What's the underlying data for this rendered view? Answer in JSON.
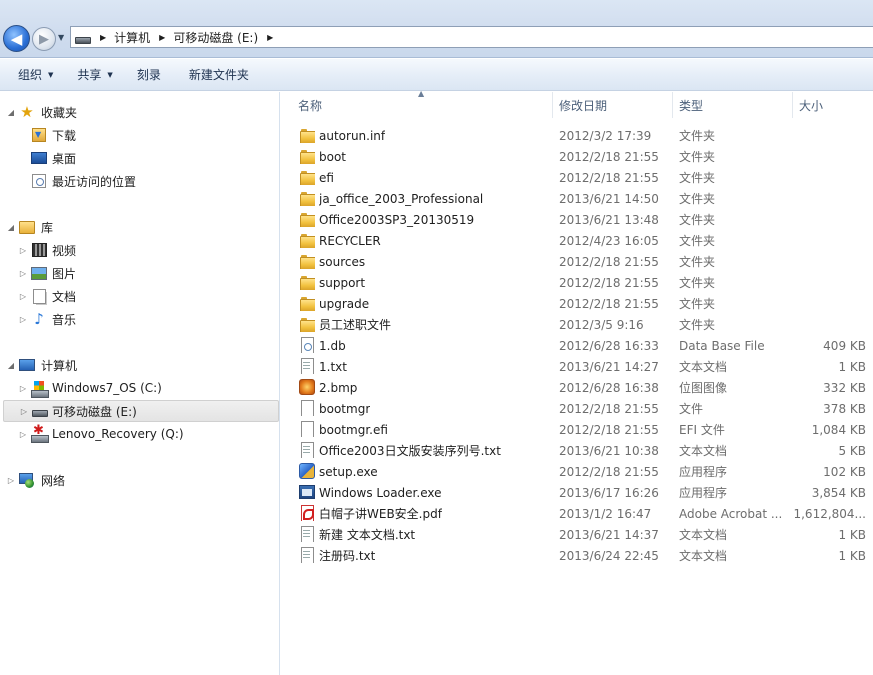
{
  "address_bar": {
    "back_icon": "back-arrow-icon",
    "forward_icon": "forward-arrow-icon",
    "breadcrumbs": [
      "计算机",
      "可移动磁盘 (E:)"
    ]
  },
  "toolbar": {
    "organize": "组织",
    "share": "共享",
    "burn": "刻录",
    "new_folder": "新建文件夹"
  },
  "nav": {
    "favorites": {
      "label": "收藏夹",
      "items": [
        "下载",
        "桌面",
        "最近访问的位置"
      ]
    },
    "libraries": {
      "label": "库",
      "items": [
        "视频",
        "图片",
        "文档",
        "音乐"
      ]
    },
    "computer": {
      "label": "计算机",
      "items": [
        "Windows7_OS (C:)",
        "可移动磁盘 (E:)",
        "Lenovo_Recovery (Q:)"
      ]
    },
    "network": {
      "label": "网络"
    },
    "selected": "可移动磁盘 (E:)"
  },
  "columns": {
    "name": "名称",
    "date": "修改日期",
    "type": "类型",
    "size": "大小"
  },
  "files": [
    {
      "name": "autorun.inf",
      "date": "2012/3/2 17:39",
      "type": "文件夹",
      "size": "",
      "icon": "folder"
    },
    {
      "name": "boot",
      "date": "2012/2/18 21:55",
      "type": "文件夹",
      "size": "",
      "icon": "folder"
    },
    {
      "name": "efi",
      "date": "2012/2/18 21:55",
      "type": "文件夹",
      "size": "",
      "icon": "folder"
    },
    {
      "name": "ja_office_2003_Professional",
      "date": "2013/6/21 14:50",
      "type": "文件夹",
      "size": "",
      "icon": "folder"
    },
    {
      "name": "Office2003SP3_20130519",
      "date": "2013/6/21 13:48",
      "type": "文件夹",
      "size": "",
      "icon": "folder"
    },
    {
      "name": "RECYCLER",
      "date": "2012/4/23 16:05",
      "type": "文件夹",
      "size": "",
      "icon": "folder"
    },
    {
      "name": "sources",
      "date": "2012/2/18 21:55",
      "type": "文件夹",
      "size": "",
      "icon": "folder"
    },
    {
      "name": "support",
      "date": "2012/2/18 21:55",
      "type": "文件夹",
      "size": "",
      "icon": "folder"
    },
    {
      "name": "upgrade",
      "date": "2012/2/18 21:55",
      "type": "文件夹",
      "size": "",
      "icon": "folder"
    },
    {
      "name": "员工述职文件",
      "date": "2012/3/5 9:16",
      "type": "文件夹",
      "size": "",
      "icon": "folder"
    },
    {
      "name": "1.db",
      "date": "2012/6/28 16:33",
      "type": "Data Base File",
      "size": "409 KB",
      "icon": "db"
    },
    {
      "name": "1.txt",
      "date": "2013/6/21 14:27",
      "type": "文本文档",
      "size": "1 KB",
      "icon": "txt"
    },
    {
      "name": "2.bmp",
      "date": "2012/6/28 16:38",
      "type": "位图图像",
      "size": "332 KB",
      "icon": "bmp"
    },
    {
      "name": "bootmgr",
      "date": "2012/2/18 21:55",
      "type": "文件",
      "size": "378 KB",
      "icon": "blank"
    },
    {
      "name": "bootmgr.efi",
      "date": "2012/2/18 21:55",
      "type": "EFI 文件",
      "size": "1,084 KB",
      "icon": "blank"
    },
    {
      "name": "Office2003日文版安装序列号.txt",
      "date": "2013/6/21 10:38",
      "type": "文本文档",
      "size": "5 KB",
      "icon": "txt"
    },
    {
      "name": "setup.exe",
      "date": "2012/2/18 21:55",
      "type": "应用程序",
      "size": "102 KB",
      "icon": "setup"
    },
    {
      "name": "Windows Loader.exe",
      "date": "2013/6/17 16:26",
      "type": "应用程序",
      "size": "3,854 KB",
      "icon": "exe"
    },
    {
      "name": "白帽子讲WEB安全.pdf",
      "date": "2013/1/2 16:47",
      "type": "Adobe Acrobat ...",
      "size": "1,612,804...",
      "icon": "pdf"
    },
    {
      "name": "新建 文本文档.txt",
      "date": "2013/6/21 14:37",
      "type": "文本文档",
      "size": "1 KB",
      "icon": "txt"
    },
    {
      "name": "注册码.txt",
      "date": "2013/6/24 22:45",
      "type": "文本文档",
      "size": "1 KB",
      "icon": "txt"
    }
  ]
}
